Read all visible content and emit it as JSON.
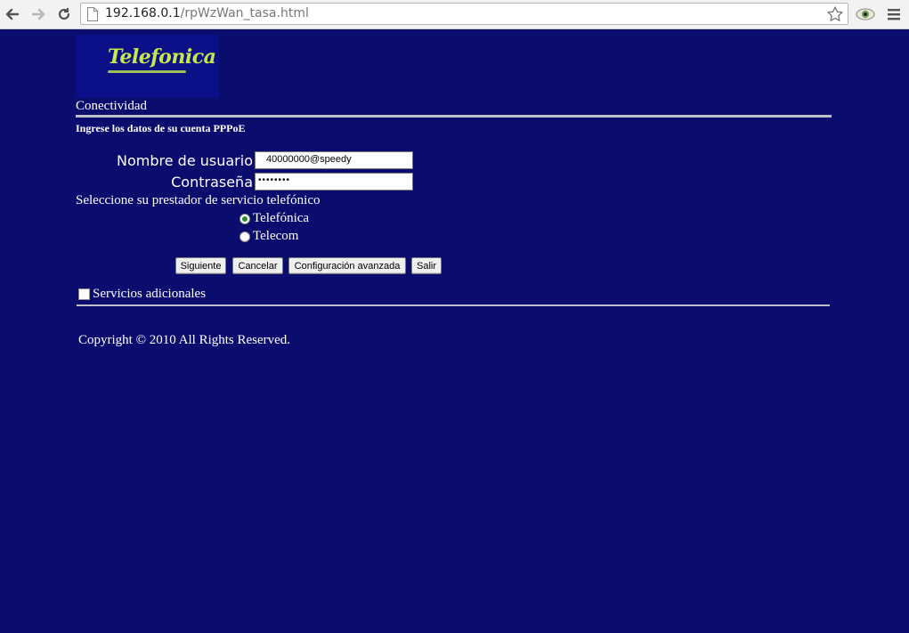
{
  "browser": {
    "url_host": "192.168.0.1",
    "url_path": "/rpWzWan_tasa.html"
  },
  "brand": {
    "logo_text": "Telefonica",
    "logo_color": "#c6e84a"
  },
  "page": {
    "section_title": "Conectividad",
    "subtitle": "Ingrese los datos de su cuenta PPPoE",
    "username_label": "Nombre de usuario",
    "username_value": "40000000@speedy",
    "password_label": "Contraseña",
    "password_value": "••••••••",
    "provider_label": "Seleccione su prestador de servicio telefónico",
    "providers": [
      {
        "label": "Telefónica",
        "selected": true
      },
      {
        "label": "Telecom",
        "selected": false
      }
    ],
    "buttons": {
      "next": "Siguiente",
      "cancel": "Cancelar",
      "advanced": "Configuración avanzada",
      "exit": "Salir"
    },
    "additional_services_label": "Servicios adicionales",
    "additional_services_checked": false,
    "copyright": "Copyright © 2010 All Rights Reserved."
  },
  "colors": {
    "background": "#0a0c6e",
    "text": "#ffffff"
  }
}
